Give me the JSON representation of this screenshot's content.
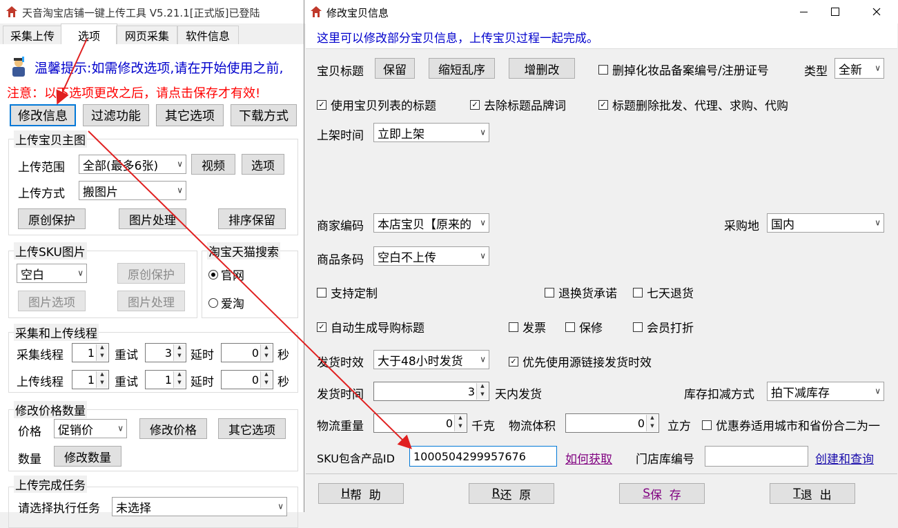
{
  "main": {
    "title": "天音淘宝店铺一键上传工具 V5.21.1[正式版]已登陆",
    "tabs": [
      "采集上传",
      "选项",
      "网页采集",
      "软件信息"
    ],
    "tip": "温馨提示:如需修改选项,请在开始使用之前,",
    "warning": "注意：以下选项更改之后，请点击保存才有效!",
    "top_buttons": [
      "修改信息",
      "过滤功能",
      "其它选项",
      "下载方式"
    ],
    "upload_main": {
      "title": "上传宝贝主图",
      "range_label": "上传范围",
      "range_value": "全部(最多6张)",
      "video": "视频",
      "options": "选项",
      "method_label": "上传方式",
      "method_value": "搬图片",
      "original": "原创保护",
      "image_proc": "图片处理",
      "sort_keep": "排序保留"
    },
    "upload_sku": {
      "title": "上传SKU图片",
      "value": "空白",
      "original": "原创保护",
      "image_options": "图片选项",
      "image_proc": "图片处理"
    },
    "search": {
      "title": "淘宝天猫搜索",
      "official": "官网",
      "aitao": "爱淘"
    },
    "threads": {
      "title": "采集和上传线程",
      "collect": "采集线程",
      "upload": "上传线程",
      "retry": "重试",
      "delay": "延时",
      "seconds": "秒",
      "collect_values": [
        "1",
        "3",
        "0"
      ],
      "upload_values": [
        "1",
        "1",
        "0"
      ]
    },
    "price": {
      "title": "修改价格数量",
      "price_label": "价格",
      "price_value": "促销价",
      "modify_price": "修改价格",
      "other": "其它选项",
      "qty_label": "数量",
      "modify_qty": "修改数量"
    },
    "finish": {
      "title": "上传完成任务",
      "label": "请选择执行任务",
      "value": "未选择"
    }
  },
  "dialog": {
    "title": "修改宝贝信息",
    "hint": "这里可以修改部分宝贝信息，上传宝贝过程一起完成。",
    "title_label": "宝贝标题",
    "keep": "保留",
    "shorten": "缩短乱序",
    "edit": "增删改",
    "remove_cosmetic": "删掉化妆品备案编号/注册证号",
    "type_label": "类型",
    "type_value": "全新",
    "use_list_title": "使用宝贝列表的标题",
    "remove_brand": "去除标题品牌词",
    "remove_words": "标题删除批发、代理、求购、代购",
    "shelf_label": "上架时间",
    "shelf_value": "立即上架",
    "merchant_code_label": "商家编码",
    "merchant_code_value": "本店宝贝【原来的",
    "purchase_label": "采购地",
    "purchase_value": "国内",
    "barcode_label": "商品条码",
    "barcode_value": "空白不上传",
    "custom": "支持定制",
    "return_promise": "退换货承诺",
    "seven_day": "七天退货",
    "auto_guide": "自动生成导购标题",
    "invoice": "发票",
    "warranty": "保修",
    "member_discount": "会员打折",
    "ship_eff_label": "发货时效",
    "ship_eff_value": "大于48小时发货",
    "prefer_source": "优先使用源链接发货时效",
    "ship_time_label": "发货时间",
    "ship_time_value": "3",
    "ship_days": "天内发货",
    "stock_label": "库存扣减方式",
    "stock_value": "拍下减库存",
    "weight_label": "物流重量",
    "weight_value": "0",
    "kg": "千克",
    "volume_label": "物流体积",
    "volume_value": "0",
    "cubic": "立方",
    "coupon": "优惠券适用城市和省份合二为一",
    "sku_label": "SKU包含产品ID",
    "sku_value": "1000504299957676",
    "how_get": "如何获取",
    "store_code_label": "门店库编号",
    "store_code_value": "",
    "create_query": "创建和查询",
    "help_key": "H",
    "help": "帮  助",
    "restore_key": "R",
    "restore": "还  原",
    "save_key": "S",
    "save": "保  存",
    "exit_key": "T",
    "exit": "退  出",
    "checks": {
      "remove_cosmetic": false,
      "use_list_title": true,
      "remove_brand": true,
      "remove_words": true,
      "custom": false,
      "return_promise": false,
      "seven_day": false,
      "auto_guide": true,
      "invoice": false,
      "warranty": false,
      "member_discount": false,
      "prefer_source": true,
      "coupon": false
    }
  },
  "colors": {
    "hint_blue": "#0000cc",
    "warning_red": "#ff0000",
    "arrow_red": "#e02020",
    "link": "#1a0dab",
    "focus": "#0078d7"
  }
}
